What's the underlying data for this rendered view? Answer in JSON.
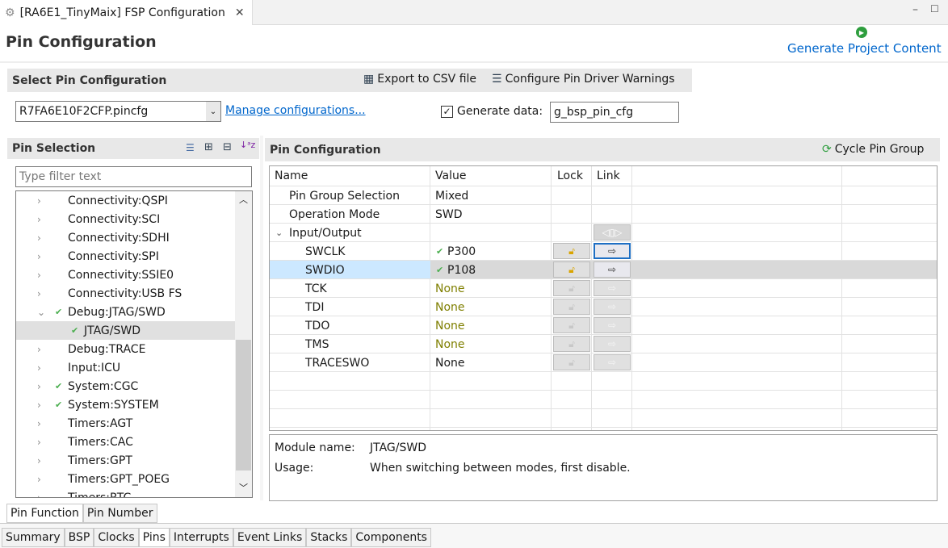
{
  "editor_tab": {
    "title": "[RA6E1_TinyMaix] FSP Configuration",
    "icon": "gear-icon"
  },
  "window_controls": {
    "minimize": "minimize-icon",
    "maximize": "maximize-icon"
  },
  "page_title": "Pin Configuration",
  "generate_label": "Generate Project Content",
  "select_section": {
    "title": "Select Pin Configuration",
    "export_label": "Export to CSV file",
    "warnings_label": "Configure Pin Driver Warnings",
    "config_value": "R7FA6E10F2CFP.pincfg",
    "manage_link": "Manage configurations...",
    "generate_data_label": "Generate data:",
    "generate_data_checked": true,
    "generate_data_value": "g_bsp_pin_cfg"
  },
  "pin_selection": {
    "title": "Pin Selection",
    "filter_placeholder": "Type filter text",
    "items": [
      {
        "label": "Connectivity:QSPI",
        "level": 1,
        "checked": false,
        "expanded": false
      },
      {
        "label": "Connectivity:SCI",
        "level": 1,
        "checked": false,
        "expanded": false
      },
      {
        "label": "Connectivity:SDHI",
        "level": 1,
        "checked": false,
        "expanded": false
      },
      {
        "label": "Connectivity:SPI",
        "level": 1,
        "checked": false,
        "expanded": false
      },
      {
        "label": "Connectivity:SSIE0",
        "level": 1,
        "checked": false,
        "expanded": false
      },
      {
        "label": "Connectivity:USB FS",
        "level": 1,
        "checked": false,
        "expanded": false
      },
      {
        "label": "Debug:JTAG/SWD",
        "level": 1,
        "checked": true,
        "expanded": true
      },
      {
        "label": "JTAG/SWD",
        "level": 2,
        "checked": true,
        "selected": true
      },
      {
        "label": "Debug:TRACE",
        "level": 1,
        "checked": false,
        "expanded": false
      },
      {
        "label": "Input:ICU",
        "level": 1,
        "checked": false,
        "expanded": false
      },
      {
        "label": "System:CGC",
        "level": 1,
        "checked": true,
        "expanded": false
      },
      {
        "label": "System:SYSTEM",
        "level": 1,
        "checked": true,
        "expanded": false
      },
      {
        "label": "Timers:AGT",
        "level": 1,
        "checked": false,
        "expanded": false
      },
      {
        "label": "Timers:CAC",
        "level": 1,
        "checked": false,
        "expanded": false
      },
      {
        "label": "Timers:GPT",
        "level": 1,
        "checked": false,
        "expanded": false
      },
      {
        "label": "Timers:GPT_POEG",
        "level": 1,
        "checked": false,
        "expanded": false
      },
      {
        "label": "Timers:RTC",
        "level": 1,
        "checked": false,
        "expanded": false
      }
    ]
  },
  "pin_config": {
    "title": "Pin Configuration",
    "cycle_label": "Cycle Pin Group",
    "columns": [
      "Name",
      "Value",
      "Lock",
      "Link"
    ],
    "rows": [
      {
        "name": "Pin Group Selection",
        "value": "Mixed",
        "level": 1
      },
      {
        "name": "Operation Mode",
        "value": "SWD",
        "level": 1
      },
      {
        "name": "Input/Output",
        "value": "",
        "level": 1,
        "group": true
      },
      {
        "name": "SWCLK",
        "value": "P300",
        "level": 2,
        "valid": true,
        "active": true
      },
      {
        "name": "SWDIO",
        "value": "P108",
        "level": 2,
        "valid": true,
        "active": true,
        "selected": true
      },
      {
        "name": "TCK",
        "value": "None",
        "level": 2,
        "muted": true
      },
      {
        "name": "TDI",
        "value": "None",
        "level": 2,
        "muted": true
      },
      {
        "name": "TDO",
        "value": "None",
        "level": 2,
        "muted": true
      },
      {
        "name": "TMS",
        "value": "None",
        "level": 2,
        "muted": true
      },
      {
        "name": "TRACESWO",
        "value": "None",
        "level": 2
      }
    ],
    "module_label": "Module name:",
    "module_value": "JTAG/SWD",
    "usage_label": "Usage:",
    "usage_value": "When switching between modes, first disable."
  },
  "view_tabs": [
    "Pin Function",
    "Pin Number"
  ],
  "bottom_tabs": [
    "Summary",
    "BSP",
    "Clocks",
    "Pins",
    "Interrupts",
    "Event Links",
    "Stacks",
    "Components"
  ],
  "active_bottom_tab": "Pins",
  "colors": {
    "link": "#0066cc",
    "selected_row": "#cce8ff",
    "muted": "#7f7f00",
    "check": "#4caf50"
  }
}
